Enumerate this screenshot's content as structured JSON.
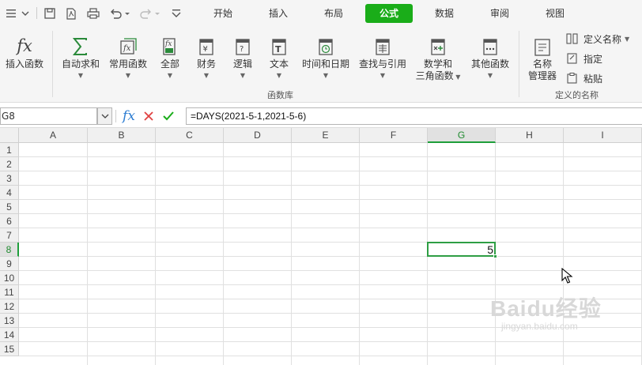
{
  "tabs": [
    {
      "label": "开始",
      "active": false
    },
    {
      "label": "插入",
      "active": false
    },
    {
      "label": "布局",
      "active": false
    },
    {
      "label": "公式",
      "active": true
    },
    {
      "label": "数据",
      "active": false
    },
    {
      "label": "审阅",
      "active": false
    },
    {
      "label": "视图",
      "active": false
    }
  ],
  "ribbon": {
    "insert_function": "插入函数",
    "auto_sum": "自动求和",
    "common_functions": "常用函数",
    "all": "全部",
    "finance": "财务",
    "logic": "逻辑",
    "text": "文本",
    "datetime": "时间和日期",
    "lookup": "查找与引用",
    "math_line1": "数学和",
    "math_line2": "三角函数",
    "other": "其他函数",
    "function_library_label": "函数库",
    "name_manager_line1": "名称",
    "name_manager_line2": "管理器",
    "define_name": "定义名称",
    "assign": "指定",
    "paste": "粘贴",
    "defined_names_label": "定义的名称"
  },
  "formula_bar": {
    "name_box": "G8",
    "formula": "=DAYS(2021-5-1,2021-5-6)"
  },
  "columns": [
    "A",
    "B",
    "C",
    "D",
    "E",
    "F",
    "G",
    "H",
    "I"
  ],
  "rows": [
    "1",
    "2",
    "3",
    "4",
    "5",
    "6",
    "7",
    "8",
    "9",
    "10",
    "11",
    "12",
    "13",
    "14",
    "15"
  ],
  "selected_cell": {
    "ref": "G8",
    "value": "5"
  },
  "watermark": {
    "line1": "Baidu经验",
    "line2": "jingyan.baidu.com"
  },
  "colors": {
    "accent": "#1aad19",
    "selection": "#2e9e44"
  }
}
